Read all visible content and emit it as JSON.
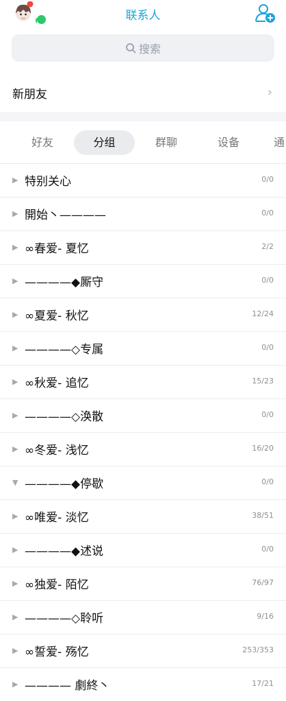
{
  "header": {
    "title": "联系人",
    "accent_color": "#20a3d8"
  },
  "search": {
    "placeholder": "搜索"
  },
  "new_friends": {
    "label": "新朋友"
  },
  "tabs": [
    {
      "label": "好友",
      "active": false
    },
    {
      "label": "分组",
      "active": true
    },
    {
      "label": "群聊",
      "active": false
    },
    {
      "label": "设备",
      "active": false
    },
    {
      "label": "通",
      "active": false
    }
  ],
  "groups": [
    {
      "name": "特别关心",
      "count": "0/0",
      "expanded": false
    },
    {
      "name": "開始丶————",
      "count": "0/0",
      "expanded": false
    },
    {
      "name": "∞春爱- 夏忆",
      "count": "2/2",
      "expanded": false
    },
    {
      "name": "————◆厮守",
      "count": "0/0",
      "expanded": false
    },
    {
      "name": "∞夏爱- 秋忆",
      "count": "12/24",
      "expanded": false
    },
    {
      "name": "————◇专属",
      "count": "0/0",
      "expanded": false
    },
    {
      "name": "∞秋爱- 追忆",
      "count": "15/23",
      "expanded": false
    },
    {
      "name": "————◇涣散",
      "count": "0/0",
      "expanded": false
    },
    {
      "name": "∞冬爱- 浅忆",
      "count": "16/20",
      "expanded": false
    },
    {
      "name": "————◆停歇",
      "count": "0/0",
      "expanded": true
    },
    {
      "name": "∞唯爱- 淡忆",
      "count": "38/51",
      "expanded": false
    },
    {
      "name": "————◆述说",
      "count": "0/0",
      "expanded": false
    },
    {
      "name": "∞独爱- 陌忆",
      "count": "76/97",
      "expanded": false
    },
    {
      "name": "————◇聆听",
      "count": "9/16",
      "expanded": false
    },
    {
      "name": "∞誓爱- 殇忆",
      "count": "253/353",
      "expanded": false
    },
    {
      "name": "———— 劇終丶",
      "count": "17/21",
      "expanded": false
    }
  ]
}
